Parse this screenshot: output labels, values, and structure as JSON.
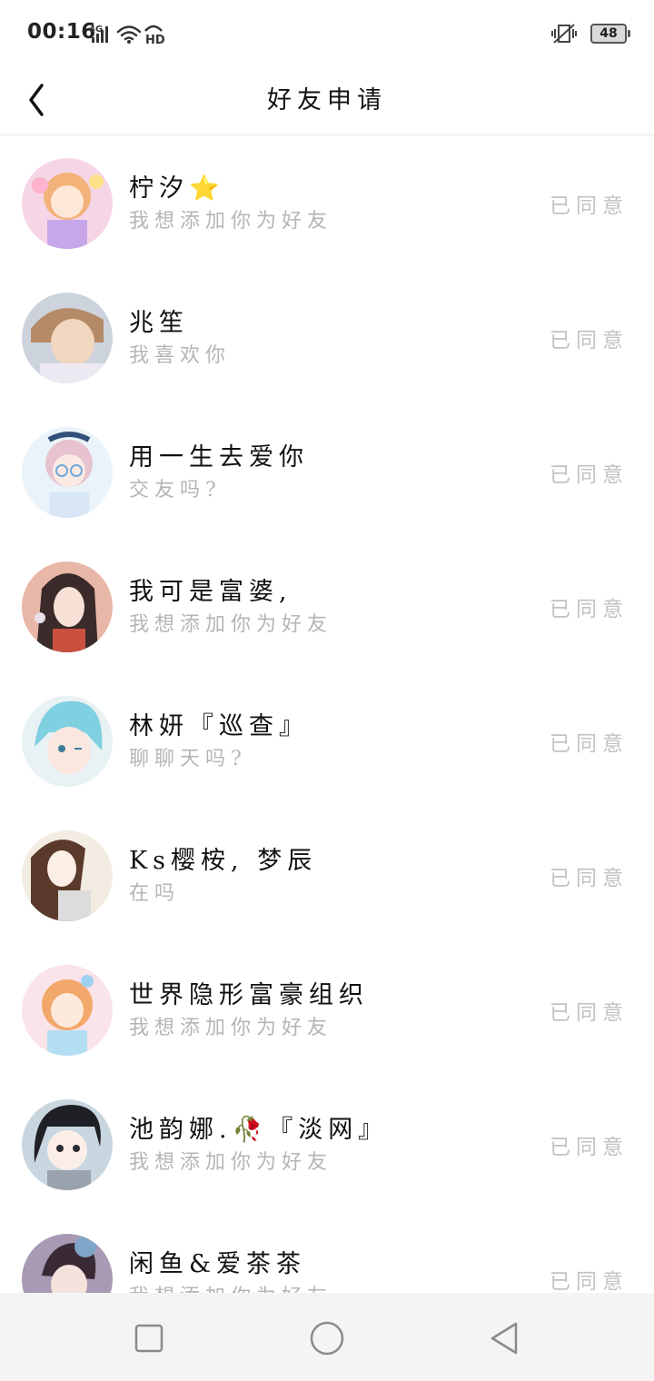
{
  "status_bar": {
    "time": "00:16",
    "network": "4G",
    "hd": "HD",
    "battery": "48",
    "icons": [
      "signal-icon",
      "wifi-icon",
      "hd-icon",
      "vibrate-icon",
      "battery-icon"
    ]
  },
  "header": {
    "title": "好友申请",
    "back_icon": "back-arrow-icon"
  },
  "requests": [
    {
      "name": "柠汐⭐",
      "message": "我想添加你为好友",
      "status": "已同意",
      "avatar_color": "#f4c9dc"
    },
    {
      "name": "兆笙",
      "message": "我喜欢你",
      "status": "已同意",
      "avatar_color": "#c9b7a6"
    },
    {
      "name": "用一生去爱你",
      "message": "交友吗?",
      "status": "已同意",
      "avatar_color": "#cfe4f2"
    },
    {
      "name": "我可是富婆,",
      "message": "我想添加你为好友",
      "status": "已同意",
      "avatar_color": "#d99a86"
    },
    {
      "name": "林妍『巡查』",
      "message": "聊聊天吗?",
      "status": "已同意",
      "avatar_color": "#8fd3e0"
    },
    {
      "name": "Ks樱桉, 梦辰",
      "message": "在吗",
      "status": "已同意",
      "avatar_color": "#e8ddd0"
    },
    {
      "name": "世界隐形富豪组织",
      "message": "我想添加你为好友",
      "status": "已同意",
      "avatar_color": "#f5c8a3"
    },
    {
      "name": "池韵娜.🥀『淡网』",
      "message": "我想添加你为好友",
      "status": "已同意",
      "avatar_color": "#8ca3b3"
    },
    {
      "name": "闲鱼&爱茶茶",
      "message": "我想添加你为好友",
      "status": "已同意",
      "avatar_color": "#9b86a6"
    }
  ],
  "nav_bar": {
    "buttons": [
      "recent-apps-icon",
      "home-icon",
      "back-icon"
    ]
  },
  "colors": {
    "background": "#ffffff",
    "secondary_text": "#b5b5b5",
    "status_text": "#c2c2c2",
    "nav_background": "#f4f4f4"
  }
}
